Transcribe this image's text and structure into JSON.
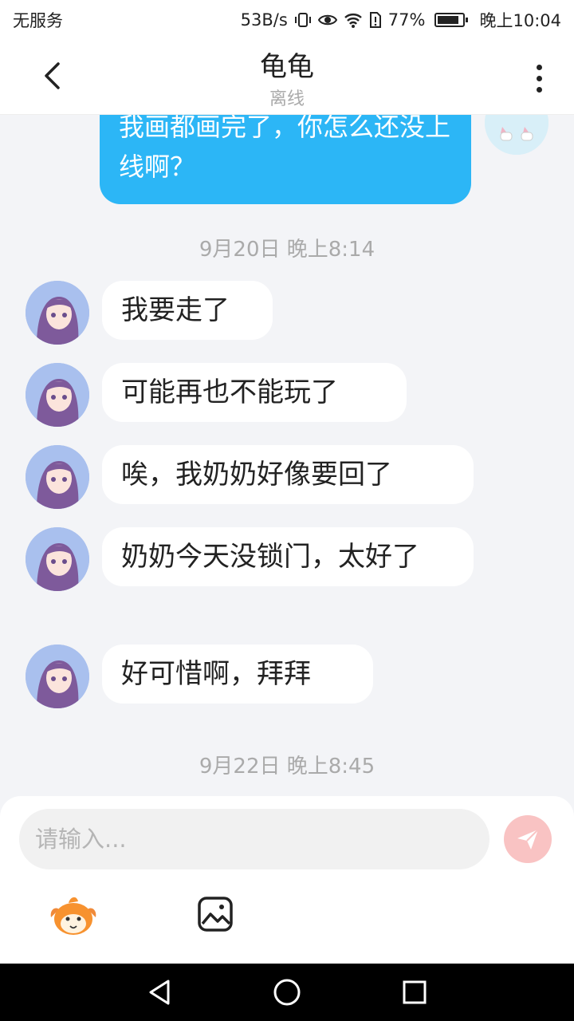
{
  "status_bar": {
    "carrier": "无服务",
    "speed": "53B/s",
    "battery": "77%",
    "time": "晚上10:04"
  },
  "header": {
    "title": "龟龟",
    "subtitle": "离线"
  },
  "messages": {
    "self_partial": "我画都画完了，你怎么还没上线啊？",
    "timestamp_1": "9月20日 晚上8:14",
    "incoming": [
      "我要走了",
      "可能再也不能玩了",
      "唉，我奶奶好像要回了",
      "奶奶今天没锁门，太好了",
      "好可惜啊，拜拜"
    ],
    "timestamp_2": "9月22日 晚上8:45"
  },
  "input": {
    "placeholder": "请输入..."
  },
  "icons": {
    "back": "chevron-left-icon",
    "more": "more-vertical-icon",
    "send": "send-icon",
    "emoji": "emoji-mascot-icon",
    "image": "image-icon"
  },
  "colors": {
    "self_bubble": "#2cb6f6",
    "send_button": "#f9c3c3",
    "background": "#f3f4f7"
  }
}
